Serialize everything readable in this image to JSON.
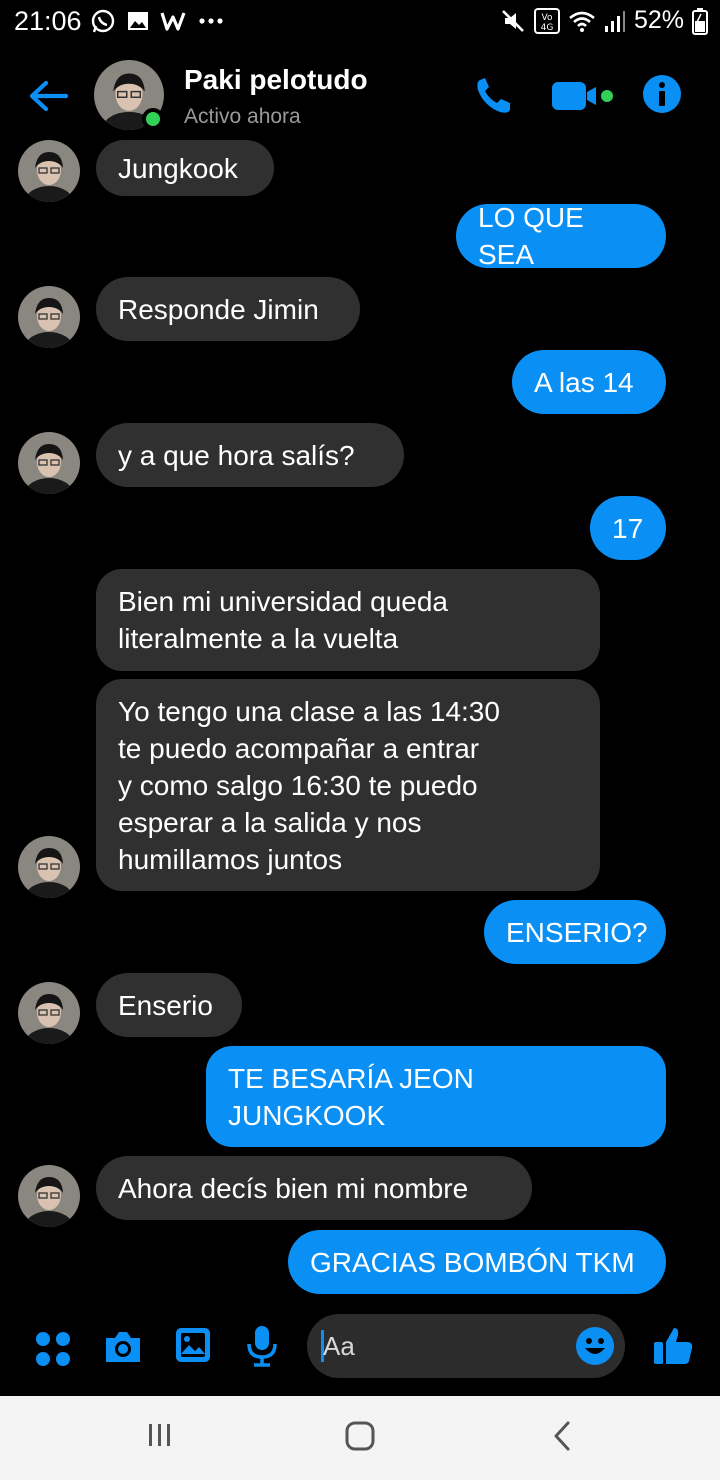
{
  "status_bar": {
    "time": "21:06",
    "battery": "52%",
    "left_icons": [
      "whatsapp-icon",
      "gallery-icon",
      "w-app-icon",
      "more-dots-icon"
    ],
    "right_icons": [
      "mute-icon",
      "volte-4g-icon",
      "wifi-icon",
      "signal-icon",
      "battery-icon"
    ]
  },
  "header": {
    "name": "Paki pelotudo",
    "status": "Activo ahora",
    "accent_color": "#0a8ff5",
    "online_color": "#31d158"
  },
  "messages": [
    {
      "dir": "in",
      "text": "Jungkook",
      "avatar": true
    },
    {
      "dir": "out",
      "text": "LO QUE SEA"
    },
    {
      "dir": "in",
      "text": "Responde Jimin",
      "avatar": true
    },
    {
      "dir": "out",
      "text": "A las 14"
    },
    {
      "dir": "in",
      "text": "y a que hora salís?",
      "avatar": true
    },
    {
      "dir": "out",
      "text": "17"
    },
    {
      "dir": "in",
      "text": "Bien mi universidad queda\nliteralmente a la vuelta",
      "avatar": false
    },
    {
      "dir": "in",
      "text": "Yo tengo una clase a las 14:30\nte puedo acompañar a entrar\ny como salgo 16:30 te puedo\nesperar a la salida y nos\nhumillamos juntos",
      "avatar": true
    },
    {
      "dir": "out",
      "text": "ENSERIO?"
    },
    {
      "dir": "in",
      "text": "Enserio",
      "avatar": true
    },
    {
      "dir": "out",
      "text": "TE BESARÍA JEON\nJUNGKOOK"
    },
    {
      "dir": "in",
      "text": "Ahora decís bien mi nombre",
      "avatar": true
    },
    {
      "dir": "out",
      "text": "GRACIAS BOMBÓN TKM"
    }
  ],
  "composer": {
    "placeholder": "Aa",
    "icons": [
      "apps-grid-icon",
      "camera-icon",
      "image-icon",
      "microphone-icon",
      "emoji-icon",
      "thumbs-up-icon"
    ]
  },
  "nav_bar": {
    "buttons": [
      "recent-apps-icon",
      "home-icon",
      "back-nav-icon"
    ]
  }
}
